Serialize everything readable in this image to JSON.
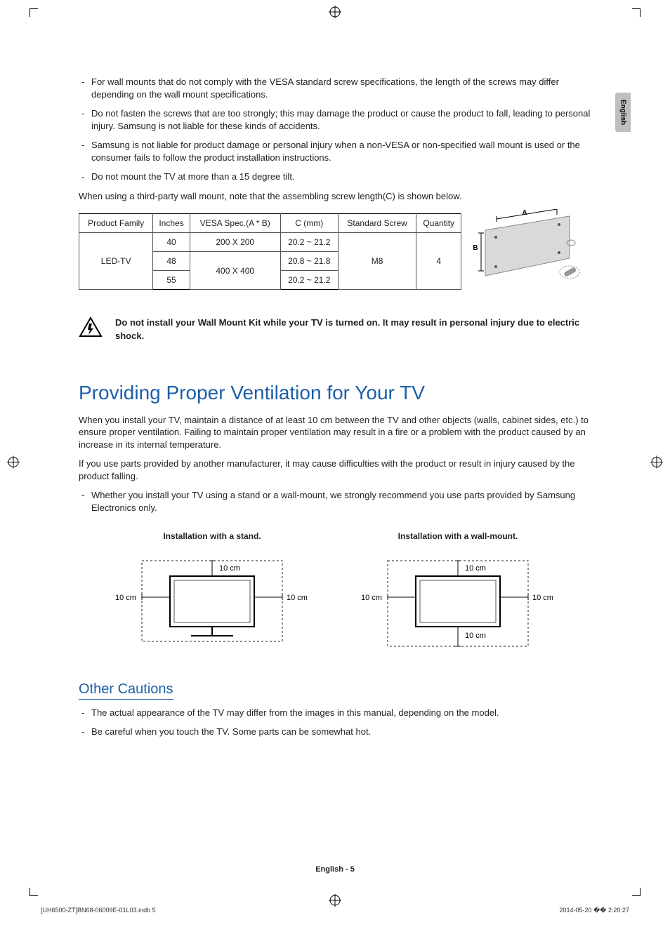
{
  "language_tab": "English",
  "bullets_top": {
    "b1": "For wall mounts that do not comply with the VESA standard screw specifications, the length of the screws may differ depending on the wall mount specifications.",
    "b2": "Do not fasten the screws that are too strongly; this may damage the product or cause the product to fall, leading to personal injury. Samsung is not liable for these kinds of accidents.",
    "b3": "Samsung is not liable for product damage or personal injury when a non-VESA or non-specified wall mount is used or the consumer fails to follow the product installation instructions.",
    "b4": "Do not mount the TV at more than a 15 degree tilt."
  },
  "screw_note": "When using a third-party wall mount, note that the assembling screw length(C) is shown below.",
  "table": {
    "headers": {
      "h1": "Product Family",
      "h2": "Inches",
      "h3": "VESA Spec.(A * B)",
      "h4": "C (mm)",
      "h5": "Standard Screw",
      "h6": "Quantity"
    },
    "family": "LED-TV",
    "rows": [
      {
        "inches": "40",
        "vesa": "200 X 200",
        "c": "20.2 ~ 21.2"
      },
      {
        "inches": "48",
        "vesa": "400 X 400",
        "c": "20.8 ~ 21.8"
      },
      {
        "inches": "55",
        "vesa": "400 X 400",
        "c": "20.2 ~ 21.2"
      }
    ],
    "screw": "M8",
    "qty": "4",
    "diagram_labels": {
      "A": "A",
      "B": "B"
    }
  },
  "warning": "Do not install your Wall Mount Kit while your TV is turned on. It may result in personal injury due to electric shock.",
  "section_title": "Providing Proper Ventilation for Your TV",
  "vent_p1": "When you install your TV, maintain a distance of at least 10 cm between the TV and other objects (walls, cabinet sides, etc.) to ensure proper ventilation. Failing to maintain proper ventilation may result in a fire or a problem with the product caused by an increase in its internal temperature.",
  "vent_p2": "If you use parts provided by another manufacturer, it may cause difficulties with the product or result in injury caused by the product falling.",
  "vent_bullet": "Whether you install your TV using a stand or a wall-mount, we strongly recommend you use parts provided by Samsung Electronics only.",
  "install": {
    "stand_caption": "Installation with a stand.",
    "wall_caption": "Installation with a wall-mount.",
    "dim": "10 cm"
  },
  "other_title": "Other Cautions",
  "other_b1": "The actual appearance of the TV may differ from the images in this manual, depending on the model.",
  "other_b2": "Be careful when you touch the TV. Some parts can be somewhat hot.",
  "footer": "English - 5",
  "imprint_left": "[UH6500-ZT]BN68-06009E-01L03.indb   5",
  "imprint_right": "2014-05-20   �� 2:20:27",
  "chart_data": {
    "type": "table",
    "title": "Wall-mount screw specification",
    "columns": [
      "Product Family",
      "Inches",
      "VESA Spec.(A * B)",
      "C (mm)",
      "Standard Screw",
      "Quantity"
    ],
    "rows": [
      [
        "LED-TV",
        "40",
        "200 X 200",
        "20.2 ~ 21.2",
        "M8",
        4
      ],
      [
        "LED-TV",
        "48",
        "400 X 400",
        "20.8 ~ 21.8",
        "M8",
        4
      ],
      [
        "LED-TV",
        "55",
        "400 X 400",
        "20.2 ~ 21.2",
        "M8",
        4
      ]
    ]
  }
}
